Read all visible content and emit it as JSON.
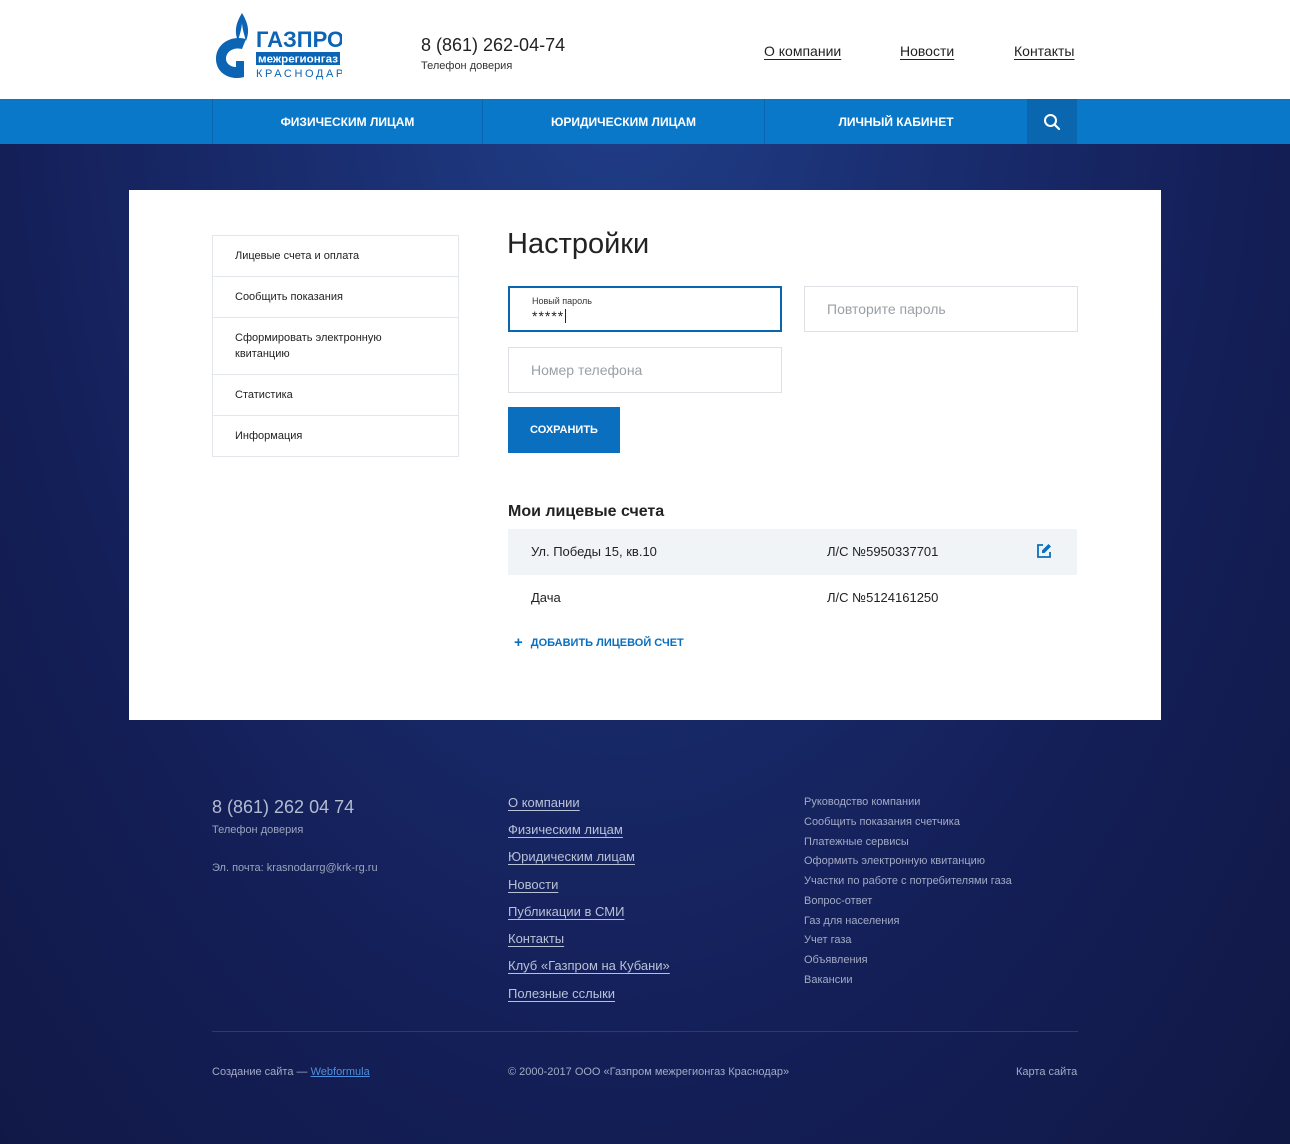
{
  "brand": {
    "line1": "ГАЗПРОМ",
    "line2": "межрегионгаз",
    "line3": "КРАСНОДАР",
    "color": "#0c64b4"
  },
  "header": {
    "phone": "8 (861) 262-04-74",
    "phone_caption": "Телефон доверия",
    "links": [
      "О компании",
      "Новости",
      "Контакты"
    ]
  },
  "mainnav": {
    "items": [
      "Физическим лицам",
      "Юридическим лицам",
      "Личный кабинет"
    ],
    "search_icon": "search-icon",
    "color": "#0a78c8"
  },
  "sidebar": {
    "items": [
      "Лицевые счета и оплата",
      "Сообщить показания",
      "Сформировать электронную квитанцию",
      "Статистика",
      "Информация"
    ]
  },
  "settings": {
    "title": "Настройки",
    "new_password": {
      "label": "Новый пароль",
      "value": "*****"
    },
    "repeat_password": {
      "placeholder": "Повторите пароль"
    },
    "phone": {
      "placeholder": "Номер телефона"
    },
    "save_label": "Сохранить"
  },
  "accounts": {
    "title": "Мои лицевые счета",
    "rows": [
      {
        "address": "Ул. Победы 15, кв.10",
        "number": "Л/С №5950337701"
      },
      {
        "address": "Дача",
        "number": "Л/С №5124161250"
      }
    ],
    "add_label": "Добавить лицевой счет"
  },
  "footer": {
    "phone": "8 (861) 262 04 74",
    "phone_caption": "Телефон доверия",
    "email": "Эл. почта: krasnodarrg@krk-rg.ru",
    "links_main": [
      "О компании",
      "Физическим лицам",
      "Юридическим лицам",
      "Новости",
      "Публикации в СМИ",
      "Контакты",
      "Клуб «Газпром на Кубани»",
      "Полезные сслыки"
    ],
    "links_secondary": [
      "Руководство компании",
      "Сообщить показания счетчика",
      "Платежные сервисы",
      "Оформить электронную квитанцию",
      "Участки по работе с потребителями газа",
      "Вопрос-ответ",
      "Газ для населения",
      "Учет газа",
      "Объявления",
      "Вакансии"
    ],
    "created_prefix": "Создание сайта —",
    "created_link": "Webformula",
    "copyright": "© 2000-2017 ООО «Газпром межрегионгаз Краснодар»",
    "sitemap": "Карта сайта"
  }
}
